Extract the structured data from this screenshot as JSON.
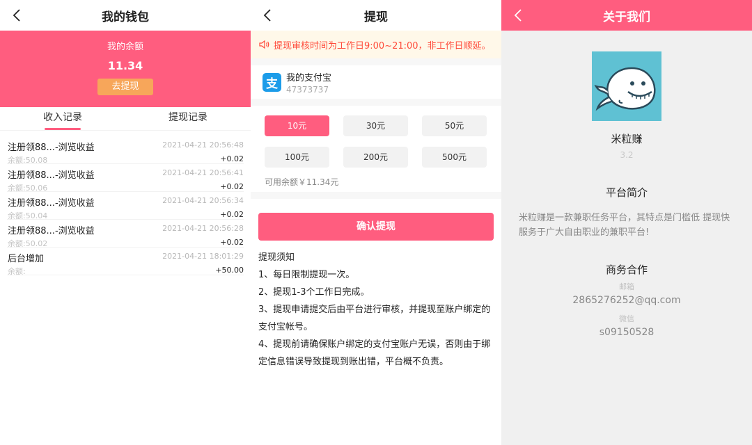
{
  "wallet": {
    "title": "我的钱包",
    "balance_label": "我的余额",
    "balance": "11.34",
    "withdraw_btn": "去提现",
    "tabs": [
      "收入记录",
      "提现记录"
    ],
    "records": [
      {
        "title": "注册领88...-浏览收益",
        "time": "2021-04-21 20:56:48",
        "balance": "余额:50.08",
        "amount": "+0.02"
      },
      {
        "title": "注册领88...-浏览收益",
        "time": "2021-04-21 20:56:41",
        "balance": "余额:50.06",
        "amount": "+0.02"
      },
      {
        "title": "注册领88...-浏览收益",
        "time": "2021-04-21 20:56:34",
        "balance": "余额:50.04",
        "amount": "+0.02"
      },
      {
        "title": "注册领88...-浏览收益",
        "time": "2021-04-21 20:56:28",
        "balance": "余额:50.02",
        "amount": "+0.02"
      },
      {
        "title": "后台增加",
        "time": "2021-04-21 18:01:29",
        "balance": "余额:",
        "amount": "+50.00"
      }
    ]
  },
  "withdraw": {
    "title": "提现",
    "notice": "提现审核时间为工作日9:00~21:00，非工作日顺延。",
    "alipay_icon_char": "支",
    "alipay_name": "我的支付宝",
    "alipay_account": "47373737",
    "amounts": [
      "10元",
      "30元",
      "50元",
      "100元",
      "200元",
      "500元"
    ],
    "selected_amount": "10元",
    "available": "可用余额￥11.34元",
    "confirm_btn": "确认提现",
    "rules": [
      "提现须知",
      "1、每日限制提现一次。",
      "2、提现1-3个工作日完成。",
      "3、提现申请提交后由平台进行审核，并提现至账户绑定的支付宝帐号。",
      "4、提现前请确保账户绑定的支付宝账户无误，否则由于绑定信息错误导致提现到账出错，平台概不负责。"
    ]
  },
  "about": {
    "title": "关于我们",
    "app_name": "米粒赚",
    "version": "3.2",
    "intro_title": "平台简介",
    "intro": "米粒赚是一款兼职任务平台，其特点是门槛低 提现快服务于广大自由职业的兼职平台!",
    "coop_title": "商务合作",
    "email_label": "邮箱",
    "email": "2865276252@qq.com",
    "wechat_label": "微信",
    "wechat": "s09150528"
  },
  "icons": {
    "back": "chevron-left-icon",
    "speaker": "speaker-icon",
    "alipay": "alipay-icon",
    "logo": "whale-logo"
  },
  "colors": {
    "brand_pink": "#ff5d7f",
    "withdraw_orange": "#f7a65a",
    "notice_red": "#ff4b3a",
    "alipay_blue": "#1c9ce9",
    "logo_bg": "#5fc1d3"
  }
}
